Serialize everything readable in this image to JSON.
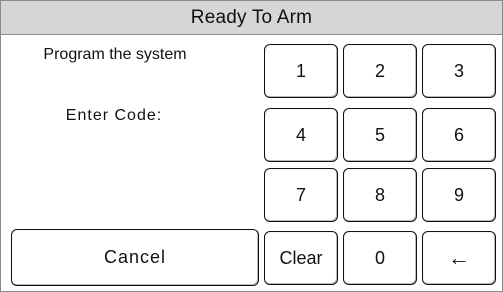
{
  "title": "Ready To Arm",
  "status": {
    "program_text": "Program the system",
    "enter_code_text": "Enter Code:"
  },
  "keypad": {
    "keys": {
      "k1": "1",
      "k2": "2",
      "k3": "3",
      "k4": "4",
      "k5": "5",
      "k6": "6",
      "k7": "7",
      "k8": "8",
      "k9": "9",
      "clear": "Clear",
      "k0": "0",
      "backspace": "←"
    },
    "cancel": "Cancel"
  },
  "icons": {
    "backspace": "left-arrow-icon"
  },
  "colors": {
    "title_bar": "#d6d6d6",
    "border": "#111111",
    "background": "#ffffff",
    "text": "#111111"
  }
}
